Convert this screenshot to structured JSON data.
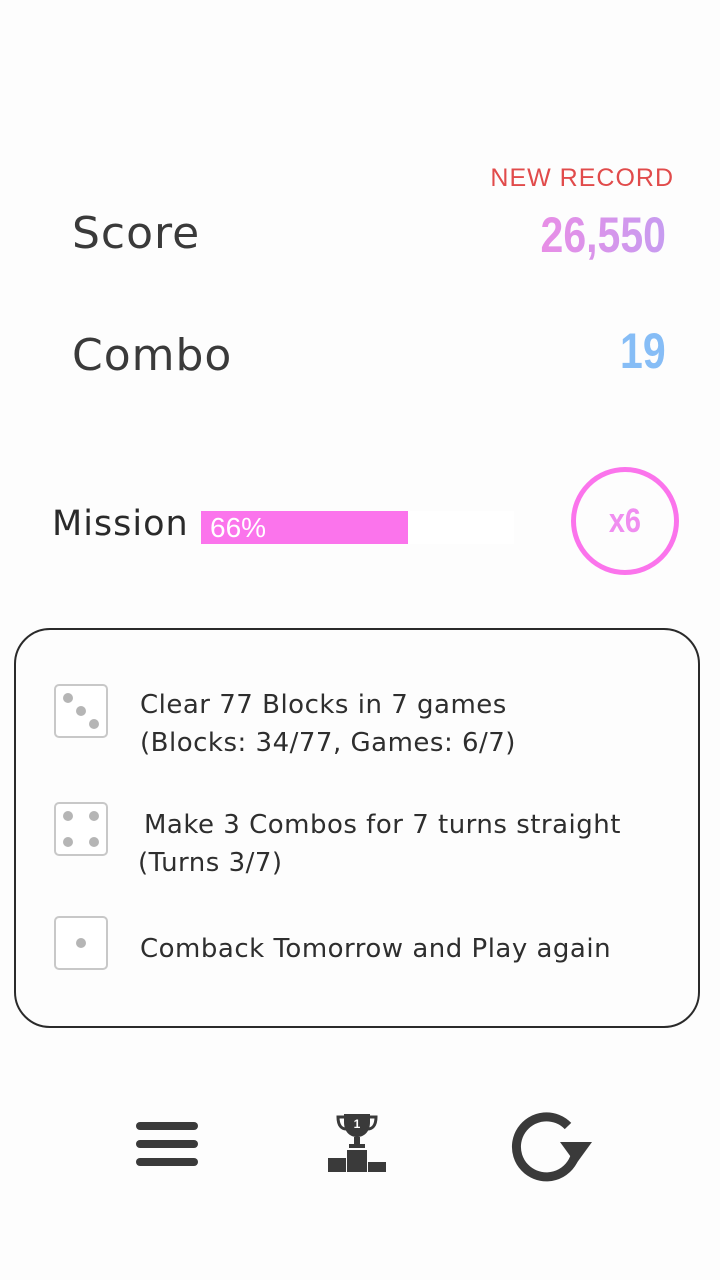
{
  "header": {
    "new_record": "NEW RECORD",
    "score_label": "Score",
    "score_value": "26,550",
    "combo_label": "Combo",
    "combo_value": "19"
  },
  "mission": {
    "label": "Mission",
    "progress_percent": 66,
    "progress_text": "66%",
    "multiplier": "x6",
    "items": [
      {
        "die_face": 3,
        "line1": "Clear 77 Blocks in 7 games",
        "line2": "(Blocks: 34/77, Games: 6/7)"
      },
      {
        "die_face": 4,
        "line1": "Make 3 Combos for 7 turns straight",
        "line2": "(Turns 3/7)"
      },
      {
        "die_face": 1,
        "line1": "Comback Tomorrow and Play again",
        "line2": ""
      }
    ]
  },
  "bottom_bar": {
    "icons": [
      "menu-icon",
      "leaderboard-trophy-icon",
      "replay-icon"
    ]
  },
  "colors": {
    "accent_pink": "#fb74ec",
    "score_gradient": [
      "#e88ee6",
      "#c79cf0"
    ],
    "combo_blue": "#86bdf6",
    "new_record_red": "#e14b4b"
  }
}
